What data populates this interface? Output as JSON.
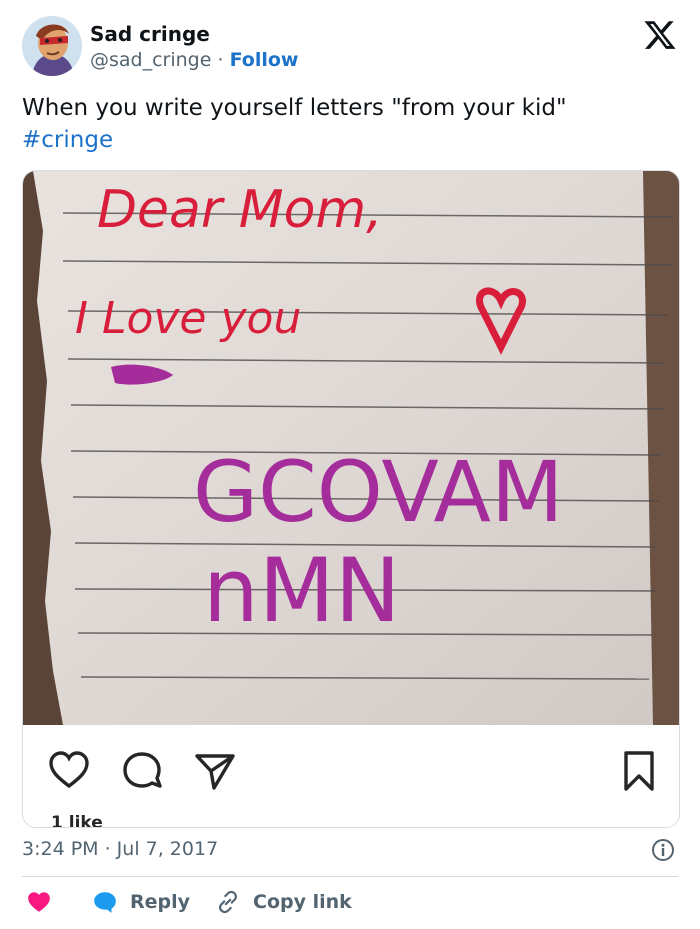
{
  "author": {
    "name": "Sad cringe",
    "handle": "@sad_cringe",
    "separator": "·",
    "follow_label": "Follow",
    "avatar_icon": "comic-hero-avatar"
  },
  "platform_icon": "x-logo-icon",
  "tweet": {
    "text": "When you write yourself letters \"from your kid\"",
    "hashtag": "#cringe"
  },
  "embedded_post": {
    "image_description_icon": "handwritten-letter-photo",
    "photo_text": {
      "line1": "Dear Mom,",
      "line2": "I Love you",
      "line3": "GCOVAM",
      "line4": "nMN"
    },
    "likes": "1 like",
    "icons": [
      "heart-icon",
      "comment-icon",
      "share-icon",
      "bookmark-icon"
    ]
  },
  "timestamp": "3:24 PM · Jul 7, 2017",
  "actions": {
    "like_icon": "heart-icon",
    "reply_label": "Reply",
    "copy_label": "Copy link"
  },
  "colors": {
    "link_blue": "#1d72c9",
    "heart_pink": "#f91880",
    "reply_blue": "#1d9bf0",
    "red_ink": "#d81e3a",
    "purple_ink": "#a42d9b"
  }
}
